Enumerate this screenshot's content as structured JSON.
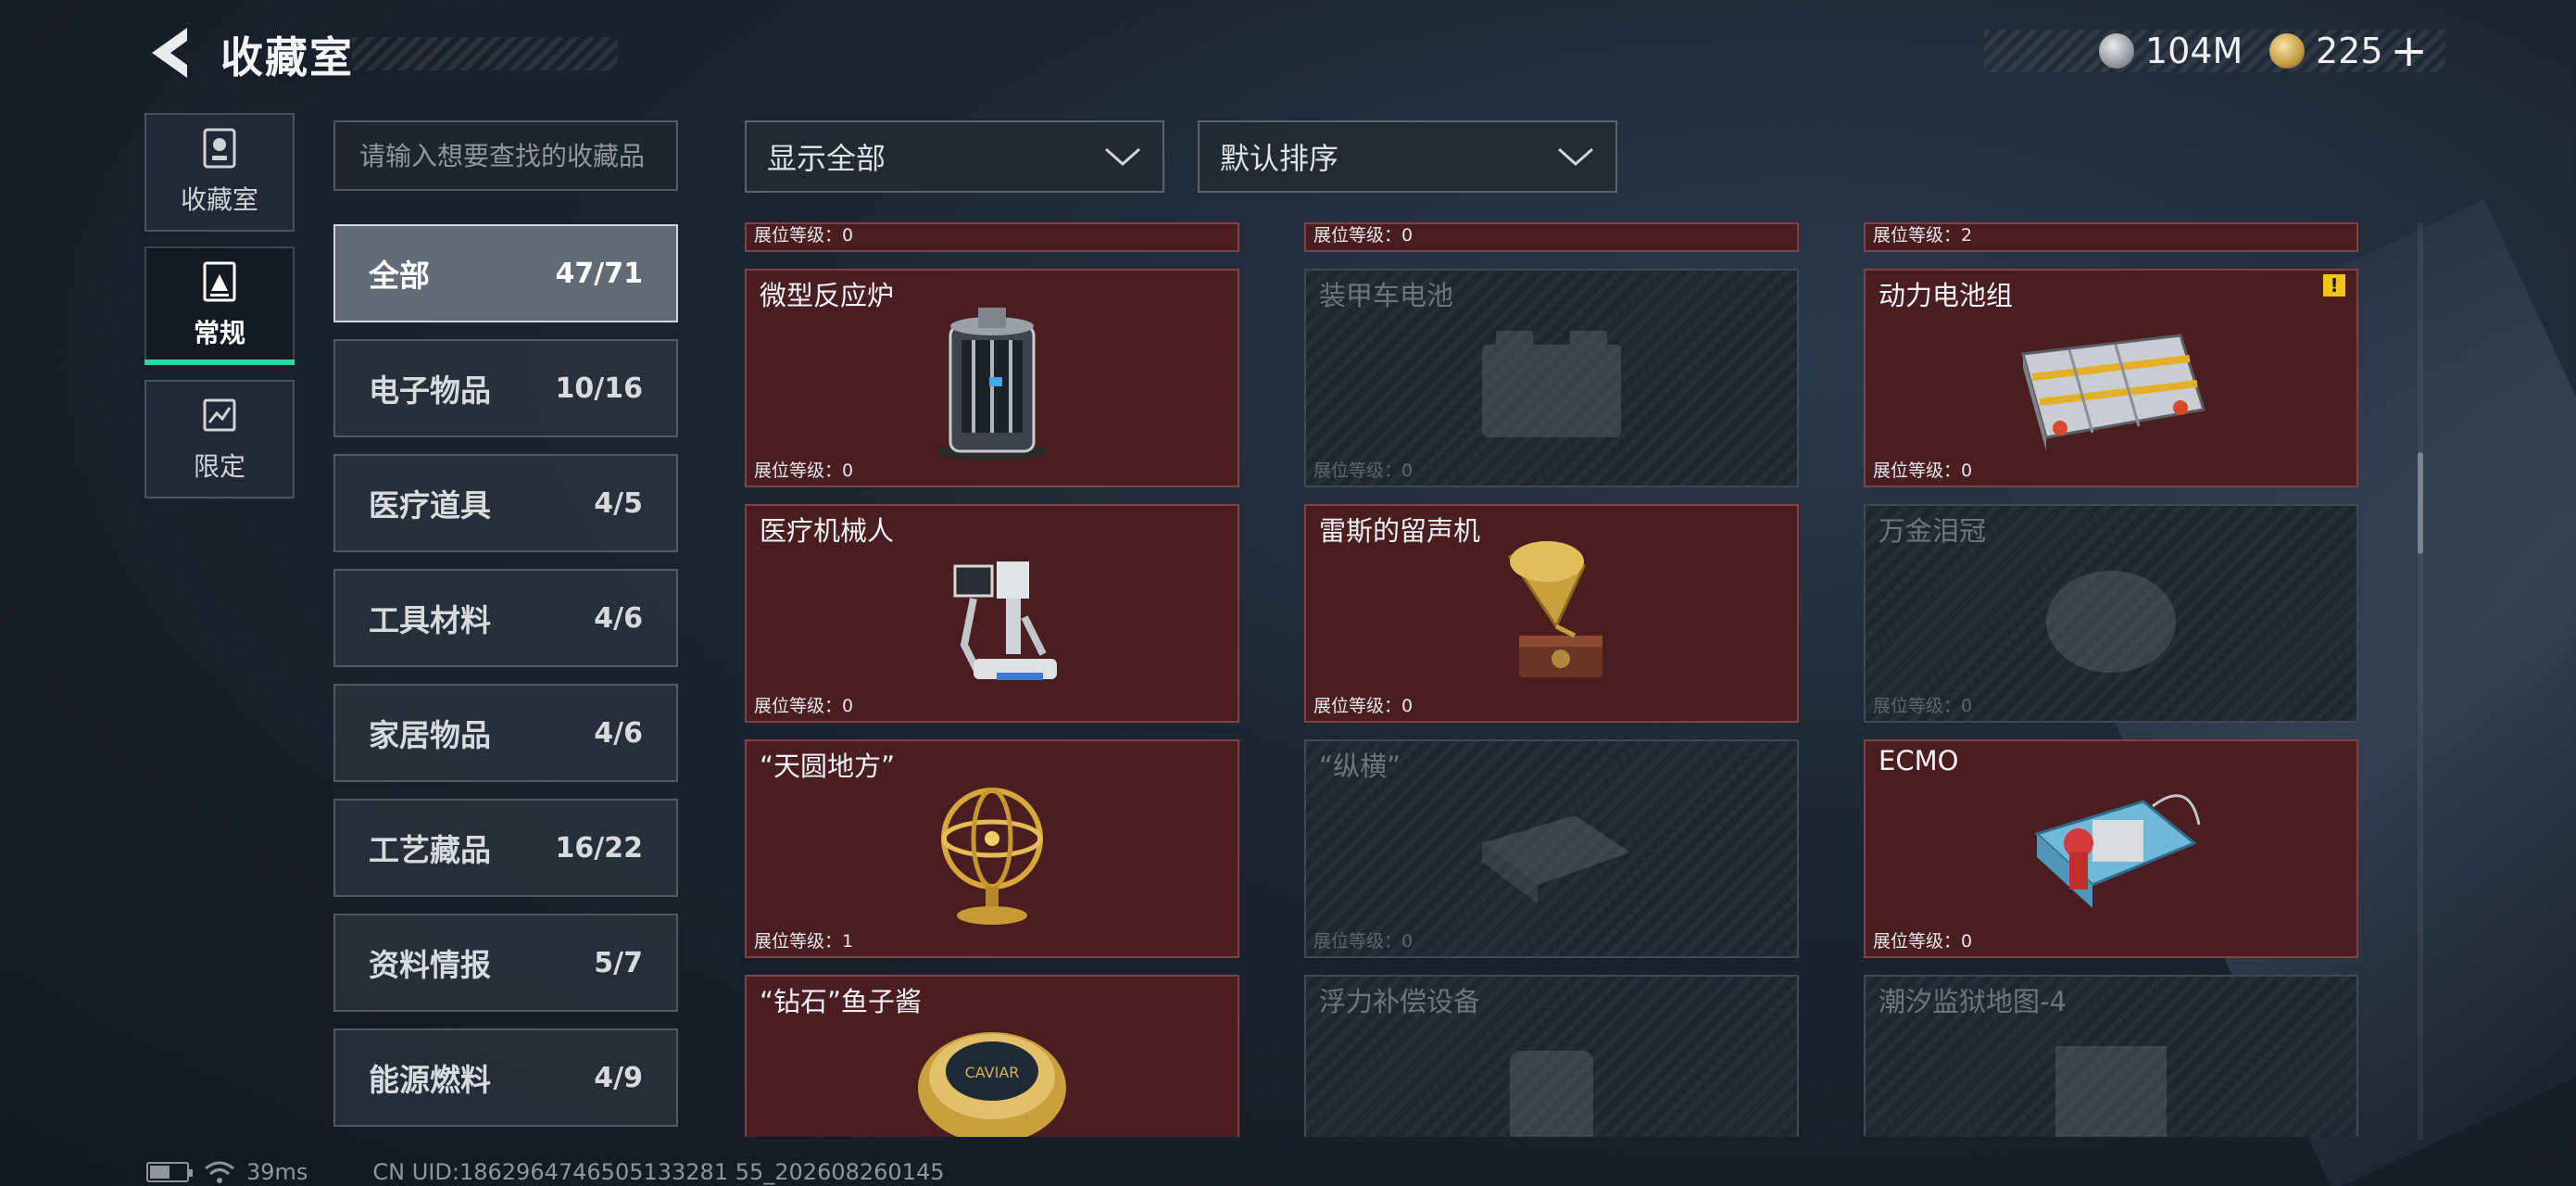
{
  "header": {
    "title": "收藏室",
    "currency_silver": "104M",
    "currency_gold": "225",
    "plus": "+"
  },
  "nav": [
    {
      "label": "收藏室",
      "icon": "trophy-icon"
    },
    {
      "label": "常规",
      "icon": "document-icon",
      "active": true
    },
    {
      "label": "限定",
      "icon": "limited-icon"
    }
  ],
  "search": {
    "placeholder": "请输入想要查找的收藏品"
  },
  "filters": {
    "display": "显示全部",
    "sort": "默认排序"
  },
  "categories": [
    {
      "name": "全部",
      "count": "47/71",
      "active": true
    },
    {
      "name": "电子物品",
      "count": "10/16"
    },
    {
      "name": "医疗道具",
      "count": "4/5"
    },
    {
      "name": "工具材料",
      "count": "4/6"
    },
    {
      "name": "家居物品",
      "count": "4/6"
    },
    {
      "name": "工艺藏品",
      "count": "16/22"
    },
    {
      "name": "资料情报",
      "count": "5/7"
    },
    {
      "name": "能源燃料",
      "count": "4/9"
    }
  ],
  "grid": {
    "top_row": [
      {
        "level": "展位等级：0"
      },
      {
        "level": "展位等级：0"
      },
      {
        "level": "展位等级：2"
      }
    ],
    "items": [
      {
        "name": "微型反应炉",
        "level": "展位等级：0",
        "owned": true,
        "icon": "reactor-icon"
      },
      {
        "name": "装甲车电池",
        "level": "展位等级：0",
        "owned": false,
        "icon": "battery-box-icon"
      },
      {
        "name": "动力电池组",
        "level": "展位等级：0",
        "owned": true,
        "icon": "power-battery-icon",
        "warning": "!"
      },
      {
        "name": "医疗机械人",
        "level": "展位等级：0",
        "owned": true,
        "icon": "medical-robot-icon"
      },
      {
        "name": "雷斯的留声机",
        "level": "展位等级：0",
        "owned": true,
        "icon": "gramophone-icon"
      },
      {
        "name": "万金泪冠",
        "level": "展位等级：0",
        "owned": false,
        "icon": "crown-icon"
      },
      {
        "name": "“天圆地方”",
        "level": "展位等级：1",
        "owned": true,
        "icon": "armillary-icon"
      },
      {
        "name": "“纵横”",
        "level": "展位等级：0",
        "owned": false,
        "icon": "board-game-icon"
      },
      {
        "name": "ECMO",
        "level": "展位等级：0",
        "owned": true,
        "icon": "ecmo-icon"
      },
      {
        "name": "“钻石”鱼子酱",
        "level": "",
        "owned": true,
        "icon": "caviar-icon",
        "caviar_label": "CAVIAR"
      },
      {
        "name": "浮力补偿设备",
        "level": "",
        "owned": false,
        "icon": "bcd-icon"
      },
      {
        "name": "潮汐监狱地图-4",
        "level": "",
        "owned": false,
        "icon": "map-icon"
      }
    ]
  },
  "footer": {
    "battery_level": 0.55,
    "ping": "39ms",
    "uid": "CN UID:1862964746505133281 55_202608260145"
  },
  "colors": {
    "owned_card": "#4a1e21",
    "locked_card": "#1e2730",
    "active_nav_accent": "#29d6a0",
    "warning": "#f0c418"
  }
}
